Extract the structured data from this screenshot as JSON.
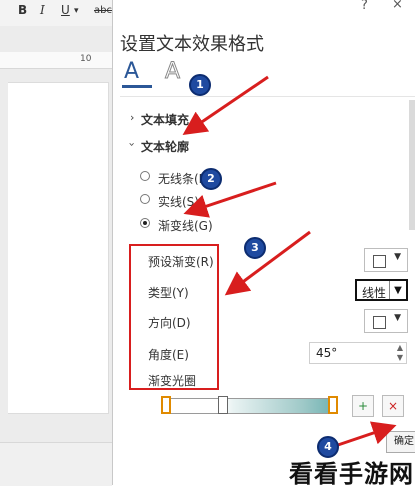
{
  "ribbon": {
    "bold_label": "B",
    "italic_label": "I",
    "underline_label": "U",
    "underline_dropdown": "▾",
    "strike_label": "abc"
  },
  "ruler": {
    "value": "10"
  },
  "pane": {
    "title": "设置文本效果格式",
    "help_label": "?",
    "close_label": "×",
    "tabs": [
      {
        "icon": "text-fill-outline-icon",
        "label": "A",
        "selected": true
      },
      {
        "icon": "text-effects-icon",
        "label": "A",
        "selected": false
      }
    ],
    "sections": {
      "text_fill": {
        "label": "文本填充",
        "expanded": false
      },
      "text_outline": {
        "label": "文本轮廓",
        "expanded": true
      }
    },
    "outline_options": [
      {
        "label": "无线条(N)",
        "selected": false
      },
      {
        "label": "实线(S)",
        "selected": false
      },
      {
        "label": "渐变线(G)",
        "selected": true
      }
    ],
    "properties": {
      "preset_gradient": "预设渐变(R)",
      "type": "类型(Y)",
      "type_value": "线性",
      "direction": "方向(D)",
      "angle": "角度(E)",
      "angle_value": "45°",
      "gradient_stops": "渐变光圈"
    },
    "ok_label": "确定"
  },
  "annotations": [
    "1",
    "2",
    "3",
    "4"
  ],
  "watermark": "看看手游网",
  "colors": {
    "accent": "#2b5797",
    "annotation_red": "#d81e1e",
    "annotation_blue": "#1f4aa0",
    "selected_stop": "#e08a00",
    "gradient_end": "#6cb0b0"
  }
}
